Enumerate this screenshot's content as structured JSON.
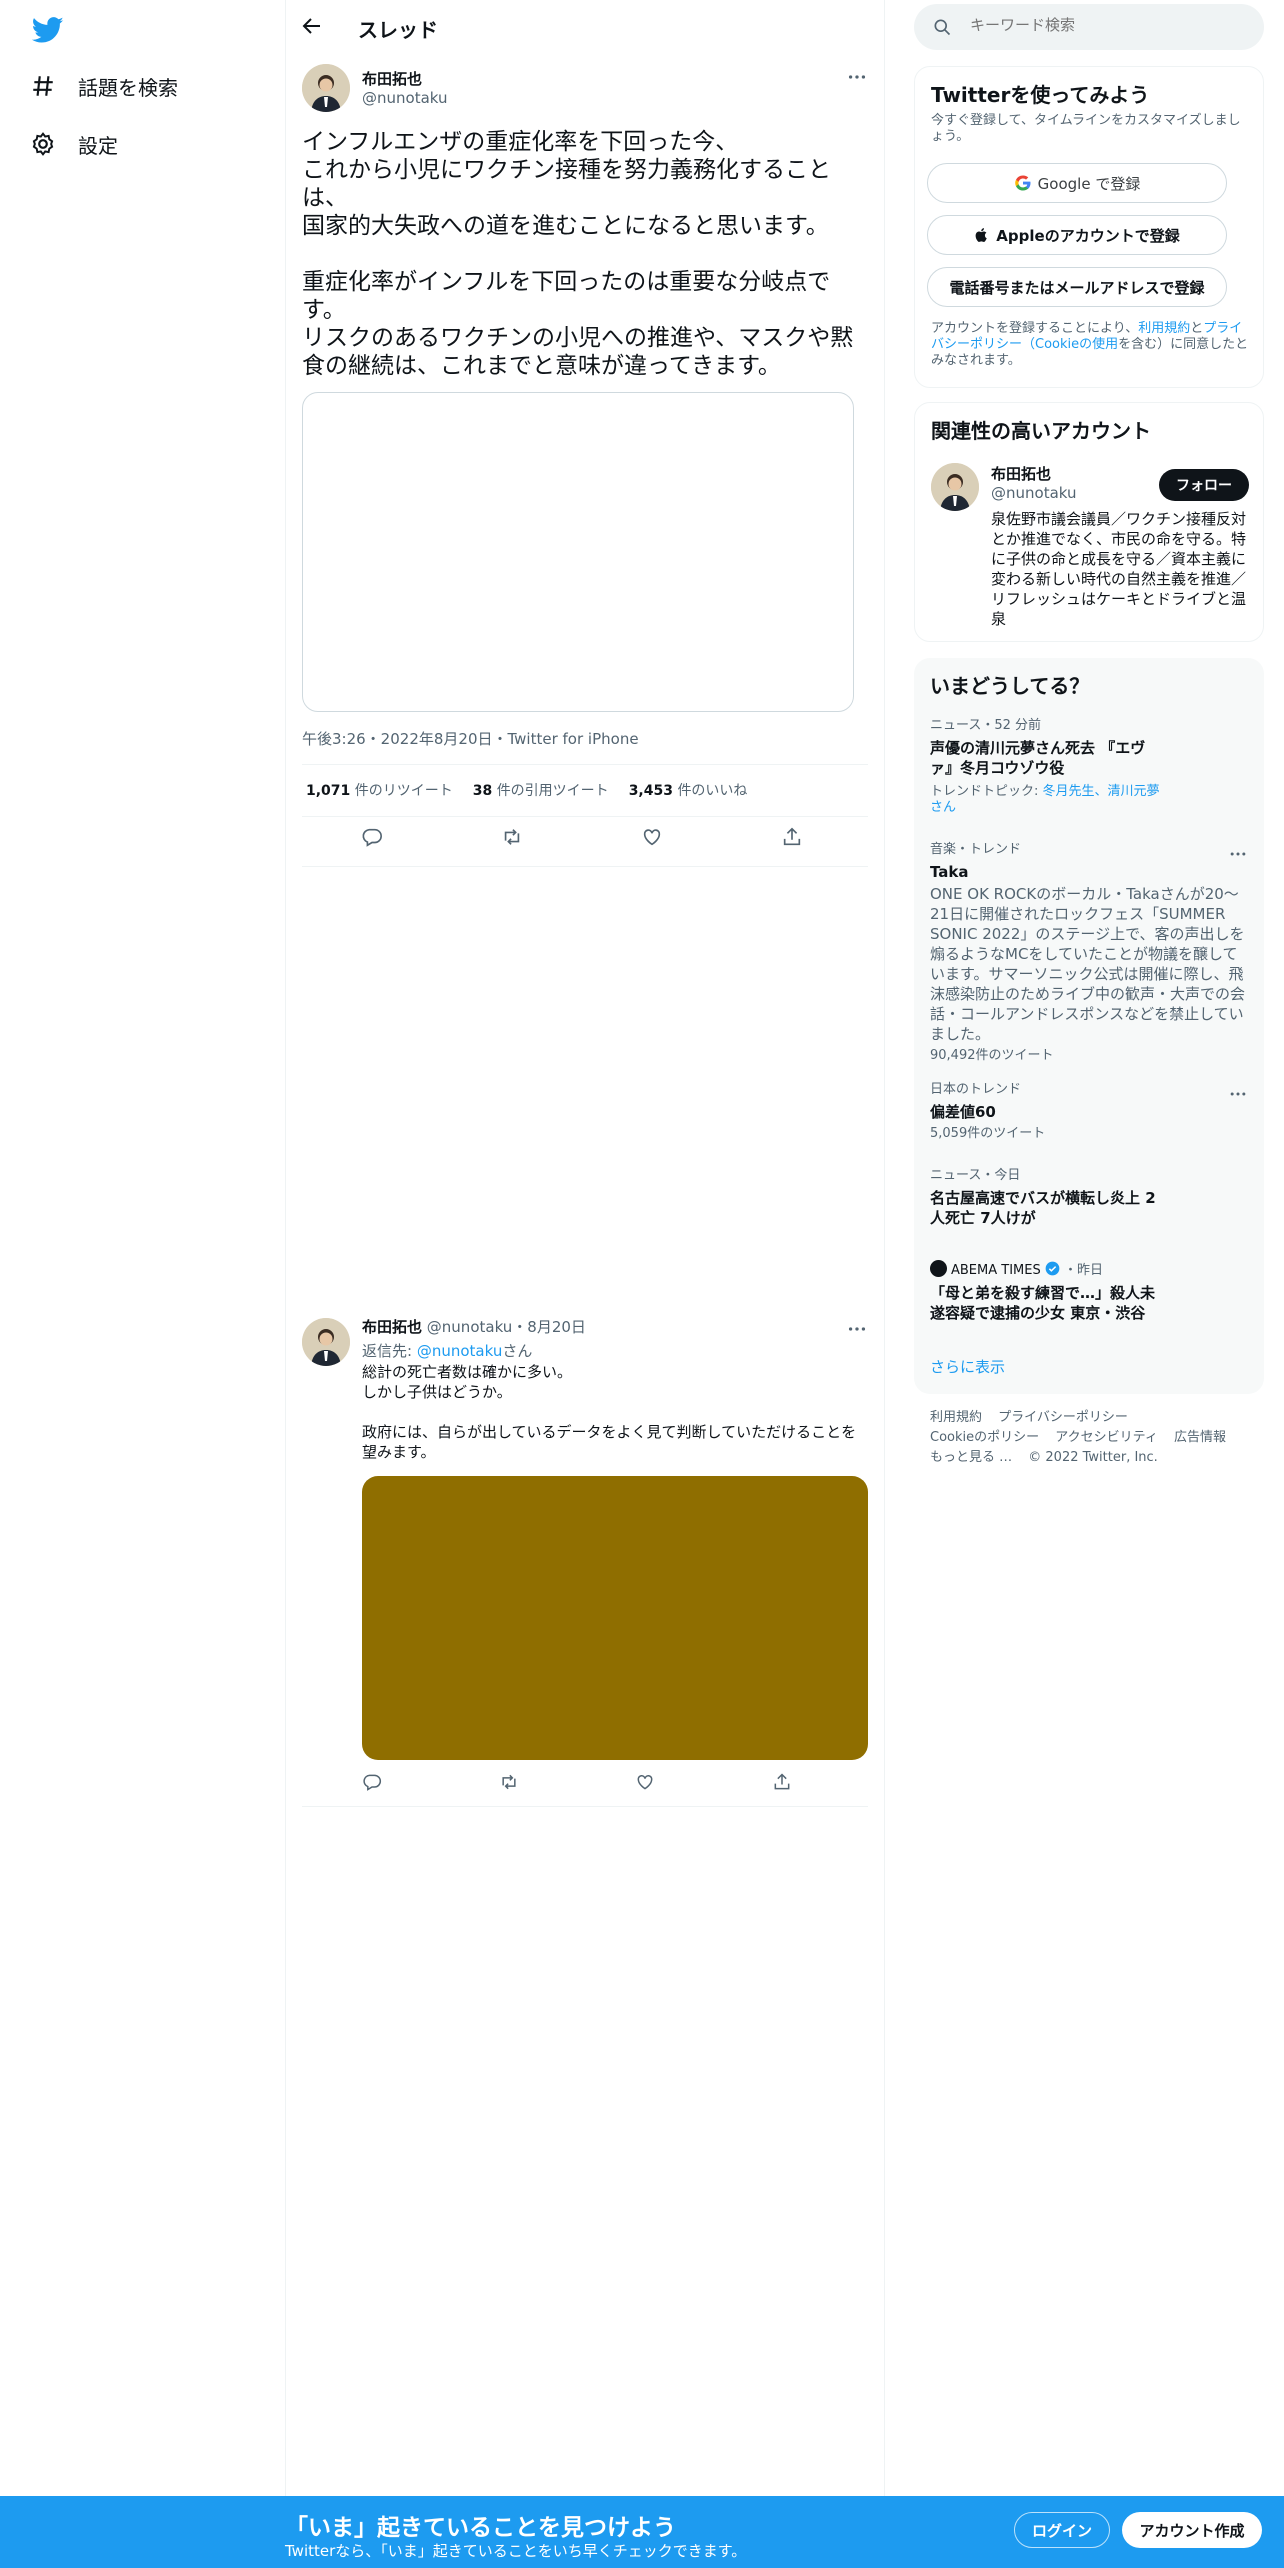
{
  "nav": {
    "logo_icon": "twitter-bird-icon",
    "items": [
      {
        "label": "話題を検索",
        "icon": "hashtag-icon"
      },
      {
        "label": "設定",
        "icon": "gear-icon"
      }
    ]
  },
  "header": {
    "title": "スレッド"
  },
  "tweet": {
    "name": "布田拓也",
    "handle": "@nunotaku",
    "text": "インフルエンザの重症化率を下回った今、\nこれから小児にワクチン接種を努力義務化することは、\n国家的大失政への道を進むことになると思います。\n\n重症化率がインフルを下回ったのは重要な分岐点です。\nリスクのあるワクチンの小児への推進や、マスクや黙食の継続は、これまでと意味が違ってきます。",
    "meta": "午後3:26・2022年8月20日・Twitter for iPhone",
    "retweets_count": "1,071",
    "retweets_label": "件のリツイート",
    "quotes_count": "38",
    "quotes_label": "件の引用ツイート",
    "likes_count": "3,453",
    "likes_label": "件のいいね"
  },
  "reply": {
    "name": "布田拓也",
    "handle_date": "@nunotaku・8月20日",
    "reply_to_prefix": "返信先: ",
    "reply_to_handle": "@nunotaku",
    "reply_to_suffix": "さん",
    "text": "総計の死亡者数は確かに多い。\nしかし子供はどうか。\n\n政府には、自らが出しているデータをよく見て判断していただけることを望みます。",
    "media_color": "#8f6e00"
  },
  "search": {
    "placeholder": "キーワード検索"
  },
  "signup": {
    "title": "Twitterを使ってみよう",
    "subtitle": "今すぐ登録して、タイムラインをカスタマイズしましょう。",
    "google_label": "Google で登録",
    "apple_label": "Appleのアカウントで登録",
    "phone_label": "電話番号またはメールアドレスで登録",
    "tos_prefix": "アカウントを登録することにより、",
    "tos_link1": "利用規約",
    "tos_mid": "と",
    "tos_link2": "プライバシーポリシー（Cookieの使用",
    "tos_suffix": "を含む）に同意したとみなされます。"
  },
  "related": {
    "title": "関連性の高いアカウント",
    "name": "布田拓也",
    "handle": "@nunotaku",
    "follow_label": "フォロー",
    "bio": "泉佐野市議会議員／ワクチン接種反対とか推進でなく、市民の命を守る。特に子供の命と成長を守る／資本主義に変わる新しい時代の自然主義を推進／リフレッシュはケーキとドライブと温泉"
  },
  "trends": {
    "title": "いまどうしてる？",
    "items": [
      {
        "meta": "ニュース・52 分前",
        "title": "声優の清川元夢さん死去 『エヴァ』冬月コウゾウ役",
        "topic_prefix": "トレンドトピック: ",
        "topic": "冬月先生、清川元夢さん"
      },
      {
        "meta": "音楽・トレンド",
        "title": "Taka",
        "desc": "ONE OK ROCKのボーカル・Takaさんが20～21日に開催されたロックフェス「SUMMER SONIC 2022」のステージ上で、客の声出しを煽るようなMCをしていたことが物議を醸しています。サマーソニック公式は開催に際し、飛沫感染防止のためライブ中の歓声・大声での会話・コールアンドレスポンスなどを禁止していました。",
        "count": "90,492件のツイート"
      },
      {
        "meta": "日本のトレンド",
        "title": "偏差値60",
        "count": "5,059件のツイート"
      },
      {
        "meta": "ニュース・今日",
        "title": "名古屋高速でバスが横転し炎上 2人死亡 7人けが"
      },
      {
        "source": "ABEMA TIMES",
        "when": "・昨日",
        "title": "「母と弟を殺す練習で…」殺人未遂容疑で逮捕の少女 東京・渋谷"
      }
    ],
    "show_more": "さらに表示"
  },
  "footer": {
    "links": [
      "利用規約",
      "プライバシーポリシー",
      "Cookieのポリシー",
      "アクセシビリティ",
      "広告情報",
      "もっと見る …",
      "© 2022 Twitter, Inc."
    ]
  },
  "bottom_bar": {
    "title": "「いま」起きていることを見つけよう",
    "subtitle": "Twitterなら、「いま」起きていることをいち早くチェックできます。",
    "login_label": "ログイン",
    "signup_label": "アカウント作成"
  },
  "colors": {
    "accent": "#1d9bf0",
    "text": "#0f1419",
    "muted": "#536471"
  }
}
